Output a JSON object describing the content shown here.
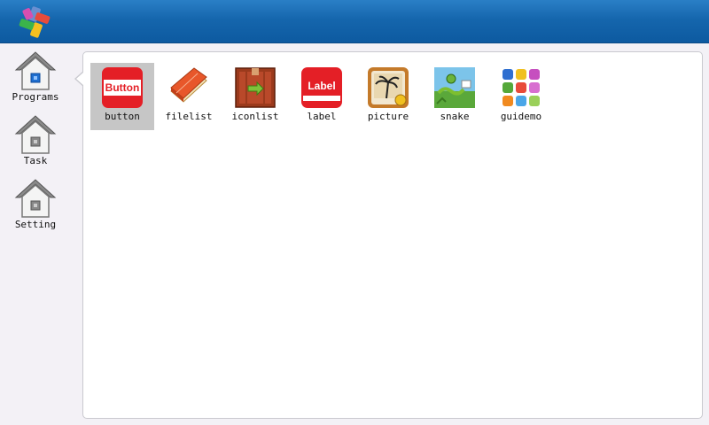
{
  "topbar": {
    "logo_icon": "pinwheel-logo-icon"
  },
  "sidebar": {
    "items": [
      {
        "label": "Programs",
        "icon": "home-icon"
      },
      {
        "label": "Task",
        "icon": "home-icon"
      },
      {
        "label": "Setting",
        "icon": "home-icon"
      }
    ]
  },
  "programs": {
    "selected_index": 0,
    "apps": [
      {
        "label": "button",
        "icon": "button-app-icon",
        "icon_text": "Button"
      },
      {
        "label": "filelist",
        "icon": "book-icon"
      },
      {
        "label": "iconlist",
        "icon": "crate-arrow-icon"
      },
      {
        "label": "label",
        "icon": "label-app-icon",
        "icon_text": "Label"
      },
      {
        "label": "picture",
        "icon": "photo-palm-icon"
      },
      {
        "label": "snake",
        "icon": "snake-icon"
      },
      {
        "label": "guidemo",
        "icon": "color-grid-icon"
      }
    ]
  },
  "colors": {
    "topbar": "#1566ad",
    "sidebar_bg": "#f3f1f6",
    "selection": "#c6c6c6",
    "button_red": "#e41f26"
  }
}
